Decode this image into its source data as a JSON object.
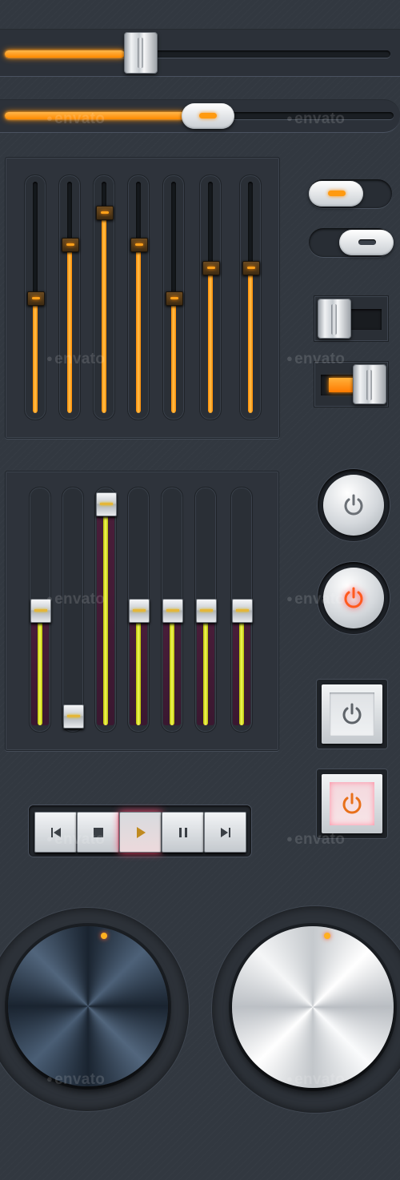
{
  "watermark": {
    "text": "envato"
  },
  "colors": {
    "accent": "#ff8c00",
    "eq_fill": "#e8ef30",
    "power_on": "#ff5a1e",
    "background": "#323840"
  },
  "sliders": {
    "h1": {
      "value": 0.35,
      "thumb": "rect"
    },
    "h2": {
      "value": 0.5,
      "thumb": "pill"
    }
  },
  "eq_orange": {
    "levels": [
      0.5,
      0.73,
      0.87,
      0.73,
      0.5,
      0.63,
      0.63
    ]
  },
  "eq_yellow": {
    "levels": [
      0.5,
      0.04,
      0.96,
      0.5,
      0.5,
      0.5,
      0.5
    ]
  },
  "toggles": [
    {
      "name": "pill-toggle-on",
      "state": "on"
    },
    {
      "name": "pill-toggle-off",
      "state": "off"
    },
    {
      "name": "square-toggle-off",
      "state": "off"
    },
    {
      "name": "square-toggle-on",
      "state": "on"
    }
  ],
  "power_buttons": [
    {
      "name": "power-round-off",
      "state": "off"
    },
    {
      "name": "power-round-on",
      "state": "on"
    },
    {
      "name": "power-square-off",
      "state": "off"
    },
    {
      "name": "power-square-on",
      "state": "on"
    }
  ],
  "transport": {
    "icons": [
      "previous-icon",
      "stop-icon",
      "play-icon",
      "pause-icon",
      "next-icon"
    ],
    "active": "play-icon"
  },
  "knobs": [
    {
      "name": "knob-dark",
      "finish": "dark-blue-brushed"
    },
    {
      "name": "knob-light",
      "finish": "silver-brushed"
    }
  ]
}
